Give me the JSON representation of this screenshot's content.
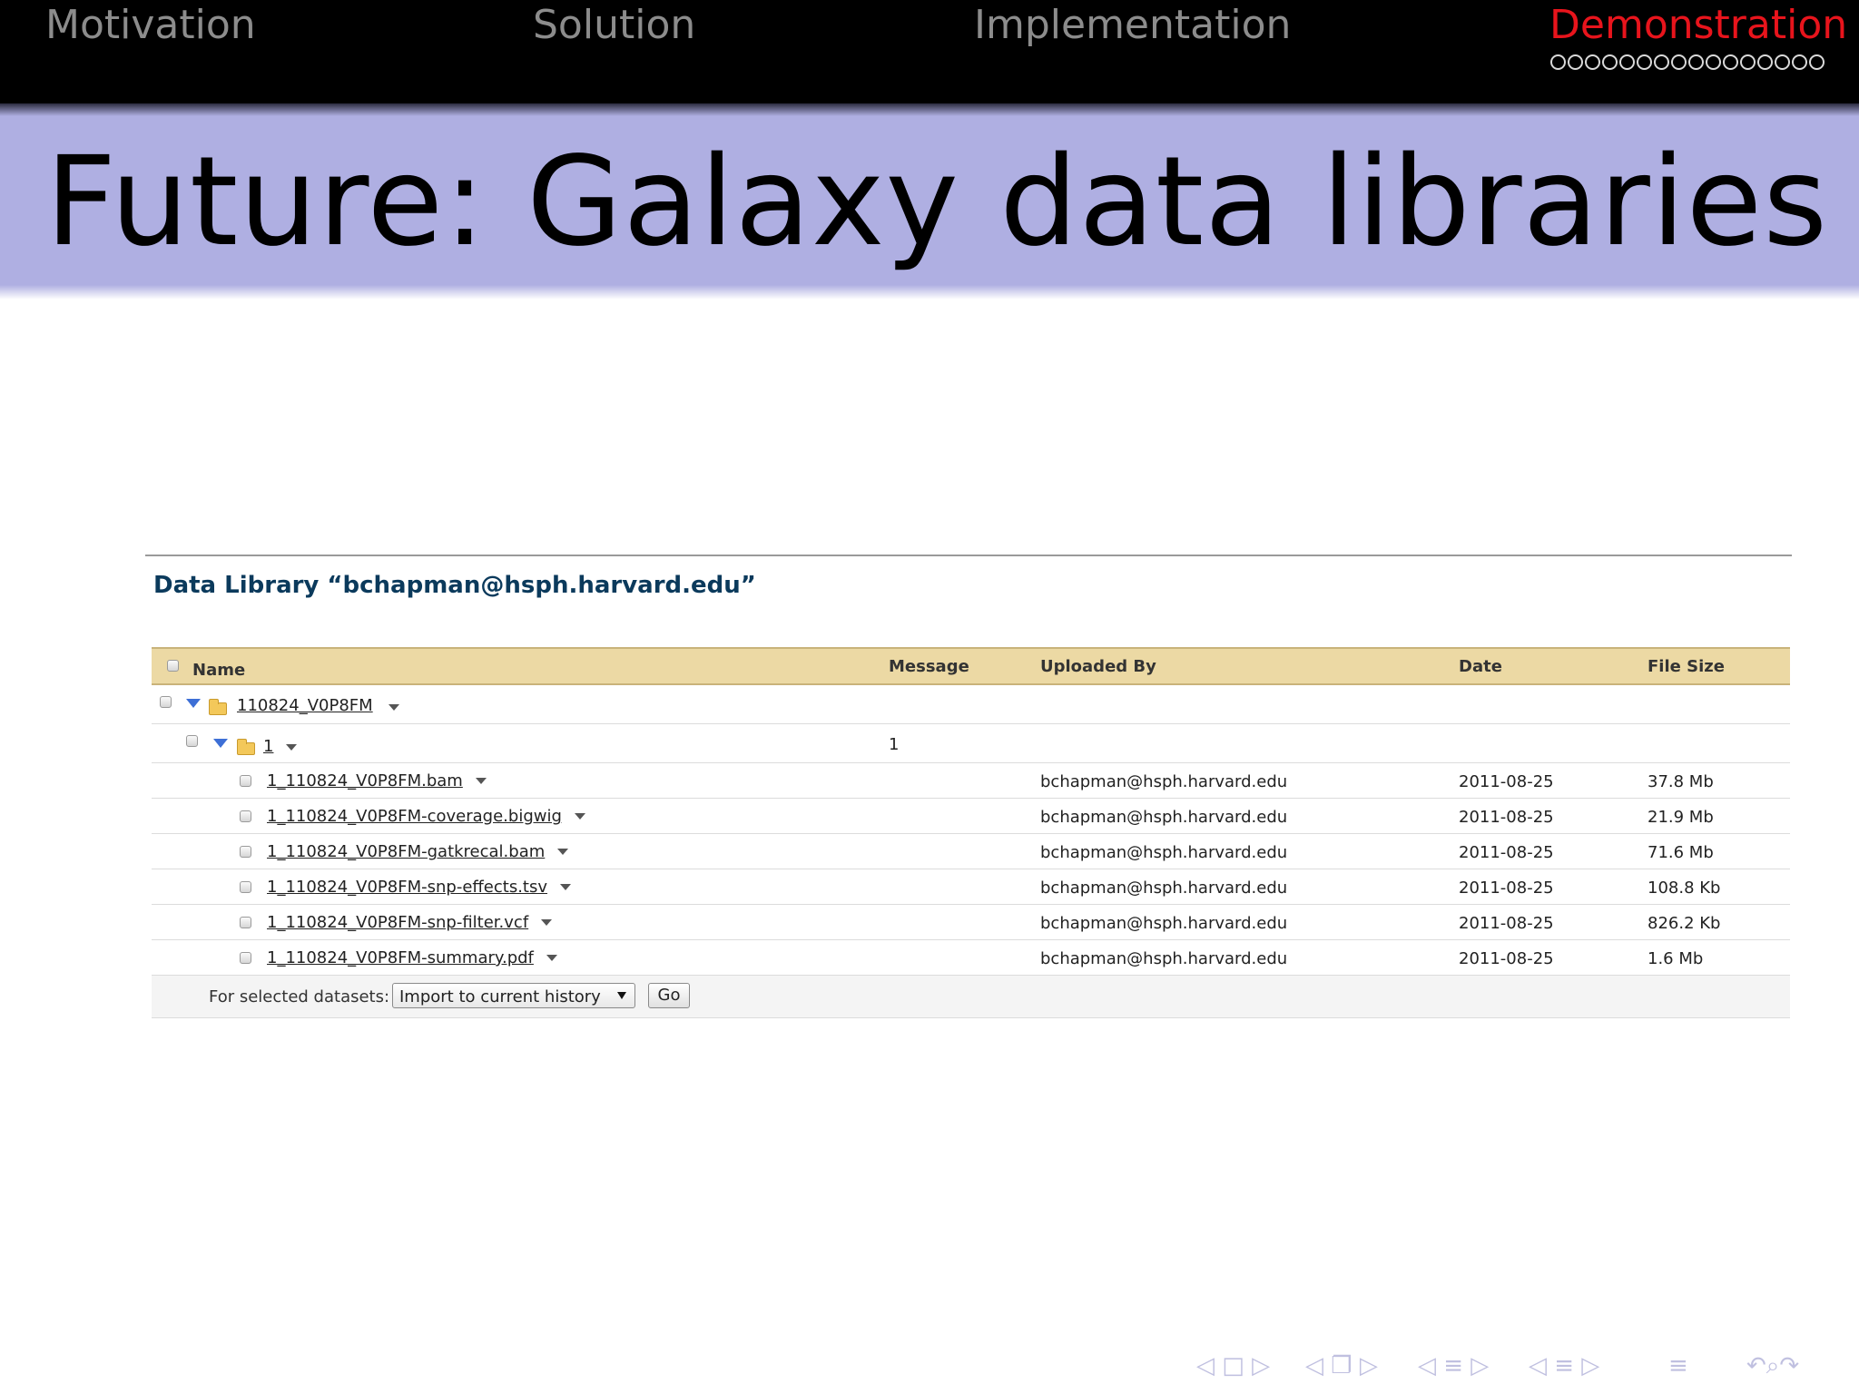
{
  "nav": {
    "sections": [
      "Motivation",
      "Solution",
      "Implementation",
      "Demonstration"
    ],
    "active_section": "Demonstration",
    "progress_dots": 16,
    "active_color": "#e8141c"
  },
  "slide": {
    "title": "Future:  Galaxy data libraries"
  },
  "library": {
    "heading": "Data Library “bchapman@hsph.harvard.edu”",
    "columns": [
      "Name",
      "Message",
      "Uploaded By",
      "Date",
      "File Size"
    ],
    "folder": {
      "name": "110824_V0P8FM"
    },
    "subfolder": {
      "name": "1",
      "message": "1"
    },
    "files": [
      {
        "name": "1_110824_V0P8FM.bam",
        "uploaded_by": "bchapman@hsph.harvard.edu",
        "date": "2011-08-25",
        "size": "37.8 Mb"
      },
      {
        "name": "1_110824_V0P8FM-coverage.bigwig",
        "uploaded_by": "bchapman@hsph.harvard.edu",
        "date": "2011-08-25",
        "size": "21.9 Mb"
      },
      {
        "name": "1_110824_V0P8FM-gatkrecal.bam",
        "uploaded_by": "bchapman@hsph.harvard.edu",
        "date": "2011-08-25",
        "size": "71.6 Mb"
      },
      {
        "name": "1_110824_V0P8FM-snp-effects.tsv",
        "uploaded_by": "bchapman@hsph.harvard.edu",
        "date": "2011-08-25",
        "size": "108.8 Kb"
      },
      {
        "name": "1_110824_V0P8FM-snp-filter.vcf",
        "uploaded_by": "bchapman@hsph.harvard.edu",
        "date": "2011-08-25",
        "size": "826.2 Kb"
      },
      {
        "name": "1_110824_V0P8FM-summary.pdf",
        "uploaded_by": "bchapman@hsph.harvard.edu",
        "date": "2011-08-25",
        "size": "1.6 Mb"
      }
    ],
    "footer": {
      "label": "For selected datasets:",
      "action_selected": "Import to current history",
      "go_label": "Go"
    }
  },
  "beamer_nav": {
    "frame": "◁ □ ▷",
    "subsection": "◁ ❐ ▷",
    "section": "◁ ≡ ▷",
    "doc": "◁ ≡ ▷",
    "align": "≡",
    "search": "↶⌕↷"
  }
}
